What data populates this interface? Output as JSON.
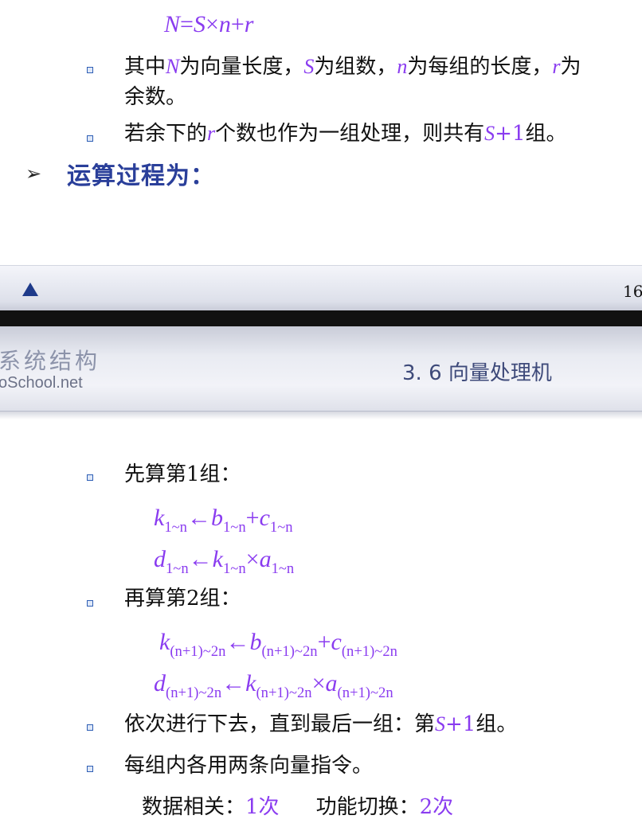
{
  "slide_top": {
    "formula": {
      "lhs": "N",
      "eq": "=",
      "s": "S",
      "times": "×",
      "n": "n",
      "plus": "+",
      "r": "r"
    },
    "bullet1": {
      "t1": "其中",
      "N": "N",
      "t2": "为向量长度，",
      "S": "S",
      "t3": "为组数，",
      "n": "n",
      "t4": "为每组的长度，",
      "r": "r",
      "t5": "为",
      "t6": "余数。"
    },
    "bullet2": {
      "t1": "若余下的",
      "r": "r",
      "t2": "个数也作为一组处理，则共有",
      "S": "S",
      "plus1": "+1",
      "t3": "组。"
    },
    "arrow_bullet": "➢",
    "heading": "运算过程为："
  },
  "footer": {
    "nav_icon": "triangle-up-icon",
    "page_number": "16"
  },
  "header": {
    "logo_line1": "系统结构",
    "logo_line2": "oSchool.net",
    "section_title": "3. 6  向量处理机"
  },
  "slide_bottom": {
    "step1_label": "先算第1组：",
    "step1_eq1": {
      "a": "k",
      "asub": "1~n",
      "arrow": "←",
      "b": "b",
      "bsub": "1~n",
      "op": "+",
      "c": "c",
      "csub": "1~n"
    },
    "step1_eq2": {
      "a": "d",
      "asub": "1~n",
      "arrow": "←",
      "b": "k",
      "bsub": "1~n",
      "op": "×",
      "c": "a",
      "csub": "1~n"
    },
    "step2_label": "再算第2组：",
    "step2_eq1": {
      "a": "k",
      "asub": "(n+1)~2n",
      "arrow": "←",
      "b": "b",
      "bsub": "(n+1)~2n",
      "op": "+",
      "c": "c",
      "csub": "(n+1)~2n"
    },
    "step2_eq2": {
      "a": "d",
      "asub": "(n+1)~2n",
      "arrow": "←",
      "b": "k",
      "bsub": "(n+1)~2n",
      "op": "×",
      "c": "a",
      "csub": "(n+1)~2n"
    },
    "step3": {
      "t1": "依次进行下去，直到最后一组：第",
      "S": "S",
      "plus1": "+1",
      "t2": "组。"
    },
    "step4": "每组内各用两条向量指令。",
    "stats": {
      "dep_label": "数据相关：",
      "dep_value": "1次",
      "switch_label": "功能切换：",
      "switch_value": "2次"
    }
  },
  "colors": {
    "math": "#8a3cf0",
    "heading": "#2a3f9a",
    "nav_triangle": "#1e3a8a"
  }
}
